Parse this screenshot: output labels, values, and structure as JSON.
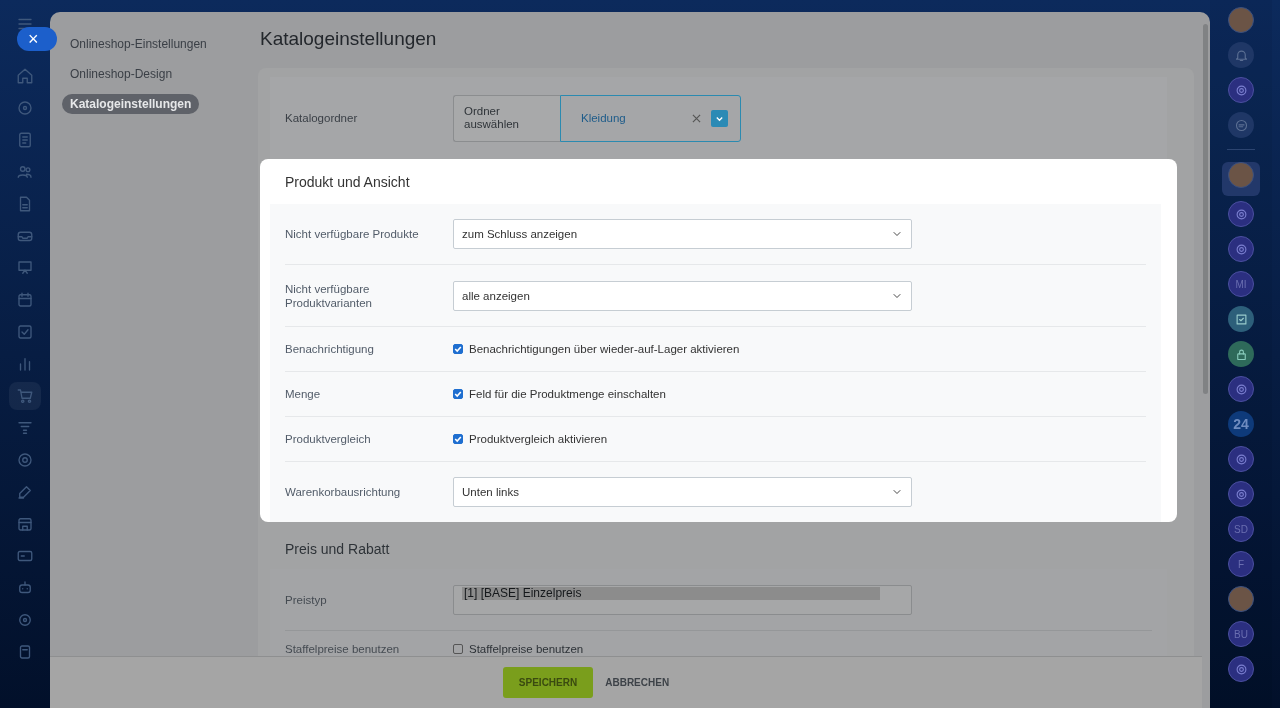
{
  "left_rail": {
    "close_button": "×"
  },
  "right_rail": {
    "items": [
      {
        "kind": "avatar"
      },
      {
        "kind": "bell"
      },
      {
        "kind": "ring"
      },
      {
        "kind": "chat"
      },
      {
        "kind": "divider"
      },
      {
        "kind": "avatar",
        "selected": true
      },
      {
        "kind": "ring"
      },
      {
        "kind": "ring"
      },
      {
        "kind": "initials",
        "text": "MI"
      },
      {
        "kind": "task"
      },
      {
        "kind": "lock"
      },
      {
        "kind": "ring"
      },
      {
        "kind": "initials",
        "text": "24"
      },
      {
        "kind": "ring"
      },
      {
        "kind": "ring"
      },
      {
        "kind": "initials",
        "text": "SD"
      },
      {
        "kind": "initials",
        "text": "F"
      },
      {
        "kind": "avatar"
      },
      {
        "kind": "initials",
        "text": "BU"
      },
      {
        "kind": "ring"
      }
    ]
  },
  "sidebar": {
    "items": [
      {
        "label": "Onlineshop-Einstellungen",
        "selected": false
      },
      {
        "label": "Onlineshop-Design",
        "selected": false
      },
      {
        "label": "Katalogeinstellungen",
        "selected": true
      }
    ]
  },
  "page_title": "Katalogeinstellungen",
  "catalog_folder": {
    "label": "Katalogordner",
    "button": "Ordner auswählen",
    "value": "Kleidung"
  },
  "product_section": {
    "title": "Produkt und Ansicht",
    "rows": [
      {
        "kind": "select",
        "label": "Nicht verfügbare Produkte",
        "value": "zum Schluss anzeigen"
      },
      {
        "kind": "select",
        "label": "Nicht verfügbare Produktvarianten",
        "value": "alle anzeigen"
      },
      {
        "kind": "checkbox",
        "label": "Benachrichtigung",
        "option": "Benachrichtigungen über wieder-auf-Lager aktivieren",
        "checked": true
      },
      {
        "kind": "checkbox",
        "label": "Menge",
        "option": "Feld für die Produktmenge einschalten",
        "checked": true
      },
      {
        "kind": "checkbox",
        "label": "Produktvergleich",
        "option": "Produktvergleich aktivieren",
        "checked": true
      },
      {
        "kind": "select",
        "label": "Warenkorbausrichtung",
        "value": "Unten links"
      }
    ]
  },
  "price_section": {
    "title": "Preis und Rabatt",
    "rows": [
      {
        "kind": "listbox",
        "label": "Preistyp",
        "value": "[1] [BASE] Einzelpreis"
      },
      {
        "kind": "checkbox",
        "label": "Staffelpreise benutzen",
        "option": "Staffelpreise benutzen",
        "checked": false
      }
    ]
  },
  "footer": {
    "save": "SPEICHERN",
    "cancel": "ABBRECHEN"
  }
}
